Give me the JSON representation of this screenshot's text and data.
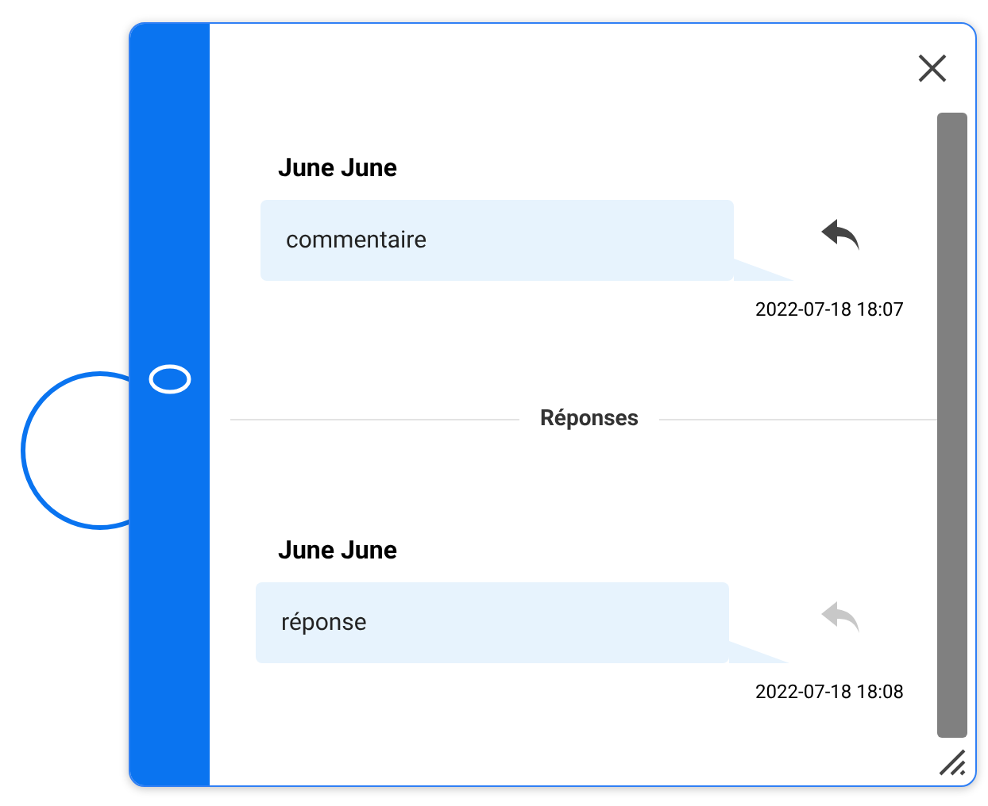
{
  "comments": [
    {
      "author": "June June",
      "text": "commentaire",
      "time": "2022-07-18 18:07",
      "reply_disabled": false
    },
    {
      "author": "June June",
      "text": "réponse",
      "time": "2022-07-18 18:08",
      "reply_disabled": true
    }
  ],
  "divider_label": "Réponses"
}
